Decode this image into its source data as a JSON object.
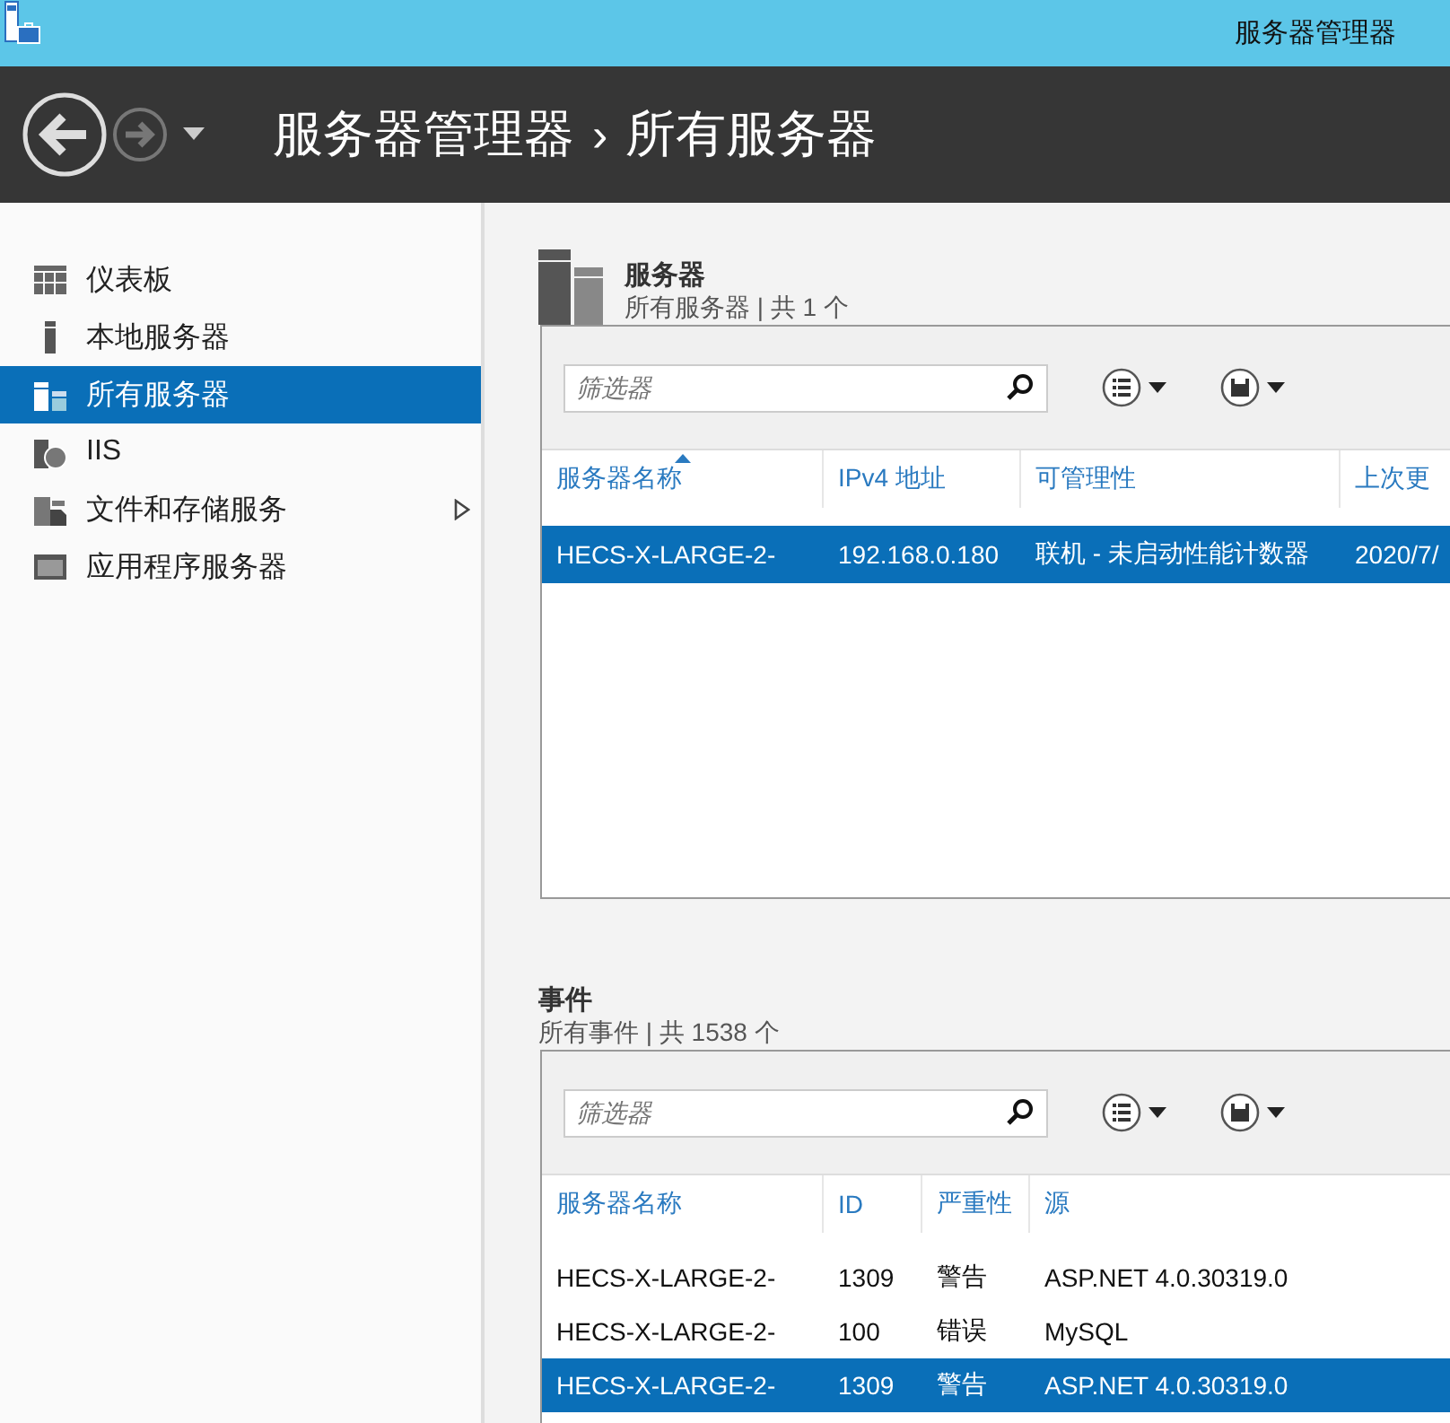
{
  "window": {
    "title": "服务器管理器"
  },
  "header": {
    "breadcrumb": [
      "服务器管理器",
      "所有服务器"
    ],
    "separator": "›"
  },
  "sidebar": {
    "items": [
      {
        "kind": "dashboard",
        "label": "仪表板",
        "selected": false,
        "expandable": false
      },
      {
        "kind": "server",
        "label": "本地服务器",
        "selected": false,
        "expandable": false
      },
      {
        "kind": "servers",
        "label": "所有服务器",
        "selected": true,
        "expandable": false
      },
      {
        "kind": "iis",
        "label": "IIS",
        "selected": false,
        "expandable": false
      },
      {
        "kind": "storage",
        "label": "文件和存储服务",
        "selected": false,
        "expandable": true
      },
      {
        "kind": "app",
        "label": "应用程序服务器",
        "selected": false,
        "expandable": false
      }
    ]
  },
  "servers": {
    "title": "服务器",
    "subtitle": "所有服务器 | 共 1 个",
    "filter": {
      "placeholder": "筛选器"
    },
    "columns": [
      {
        "label": "服务器名称",
        "sorted": true
      },
      {
        "label": "IPv4 地址",
        "sorted": false
      },
      {
        "label": "可管理性",
        "sorted": false
      },
      {
        "label": "上次更",
        "sorted": false
      }
    ],
    "rows": [
      {
        "cells": [
          "HECS-X-LARGE-2-",
          "192.168.0.180",
          "联机 - 未启动性能计数器",
          "2020/7/"
        ],
        "selected": true
      }
    ]
  },
  "events": {
    "title": "事件",
    "subtitle": "所有事件 | 共 1538 个",
    "filter": {
      "placeholder": "筛选器"
    },
    "columns": [
      {
        "label": "服务器名称",
        "sorted": false
      },
      {
        "label": "ID",
        "sorted": false
      },
      {
        "label": "严重性",
        "sorted": false
      },
      {
        "label": "源",
        "sorted": false
      }
    ],
    "rows": [
      {
        "cells": [
          "HECS-X-LARGE-2-",
          "1309",
          "警告",
          "ASP.NET 4.0.30319.0"
        ],
        "selected": false
      },
      {
        "cells": [
          "HECS-X-LARGE-2-",
          "100",
          "错误",
          "MySQL"
        ],
        "selected": false
      },
      {
        "cells": [
          "HECS-X-LARGE-2-",
          "1309",
          "警告",
          "ASP.NET 4.0.30319.0"
        ],
        "selected": true
      }
    ]
  }
}
